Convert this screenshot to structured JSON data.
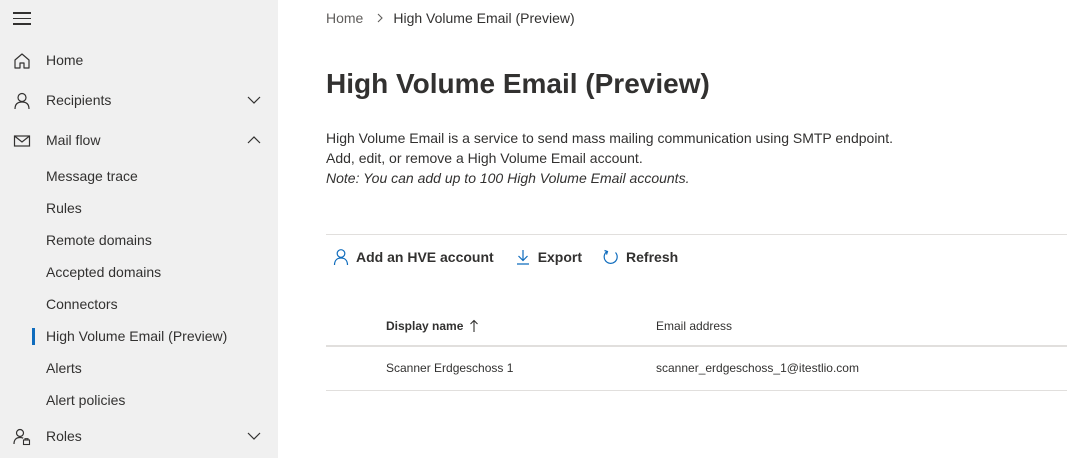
{
  "sidebar": {
    "menu_icon": "hamburger-icon",
    "items": [
      {
        "label": "Home",
        "icon": "home-icon"
      },
      {
        "label": "Recipients",
        "icon": "person-icon",
        "chevron": "down"
      },
      {
        "label": "Mail flow",
        "icon": "mail-icon",
        "chevron": "up",
        "expanded": true,
        "children": [
          {
            "label": "Message trace"
          },
          {
            "label": "Rules"
          },
          {
            "label": "Remote domains"
          },
          {
            "label": "Accepted domains"
          },
          {
            "label": "Connectors"
          },
          {
            "label": "High Volume Email (Preview)",
            "selected": true
          },
          {
            "label": "Alerts"
          },
          {
            "label": "Alert policies"
          }
        ]
      },
      {
        "label": "Roles",
        "icon": "roles-icon",
        "chevron": "down"
      }
    ]
  },
  "breadcrumb": {
    "home": "Home",
    "current": "High Volume Email (Preview)"
  },
  "page": {
    "title": "High Volume Email (Preview)",
    "description_line1": "High Volume Email is a service to send mass mailing communication using SMTP endpoint.",
    "description_line2": "Add, edit, or remove a High Volume Email account.",
    "note": "Note: You can add up to 100 High Volume Email accounts."
  },
  "toolbar": {
    "add_label": "Add an HVE account",
    "export_label": "Export",
    "refresh_label": "Refresh"
  },
  "table": {
    "columns": [
      "Display name",
      "Email address"
    ],
    "sort": "ascending",
    "rows": [
      {
        "display_name": "Scanner Erdgeschoss 1",
        "email": "scanner_erdgeschoss_1@itestlio.com"
      }
    ]
  },
  "colors": {
    "sidebar_bg": "#f0f0f0",
    "accent": "#0f6cbd",
    "text": "#323130"
  }
}
